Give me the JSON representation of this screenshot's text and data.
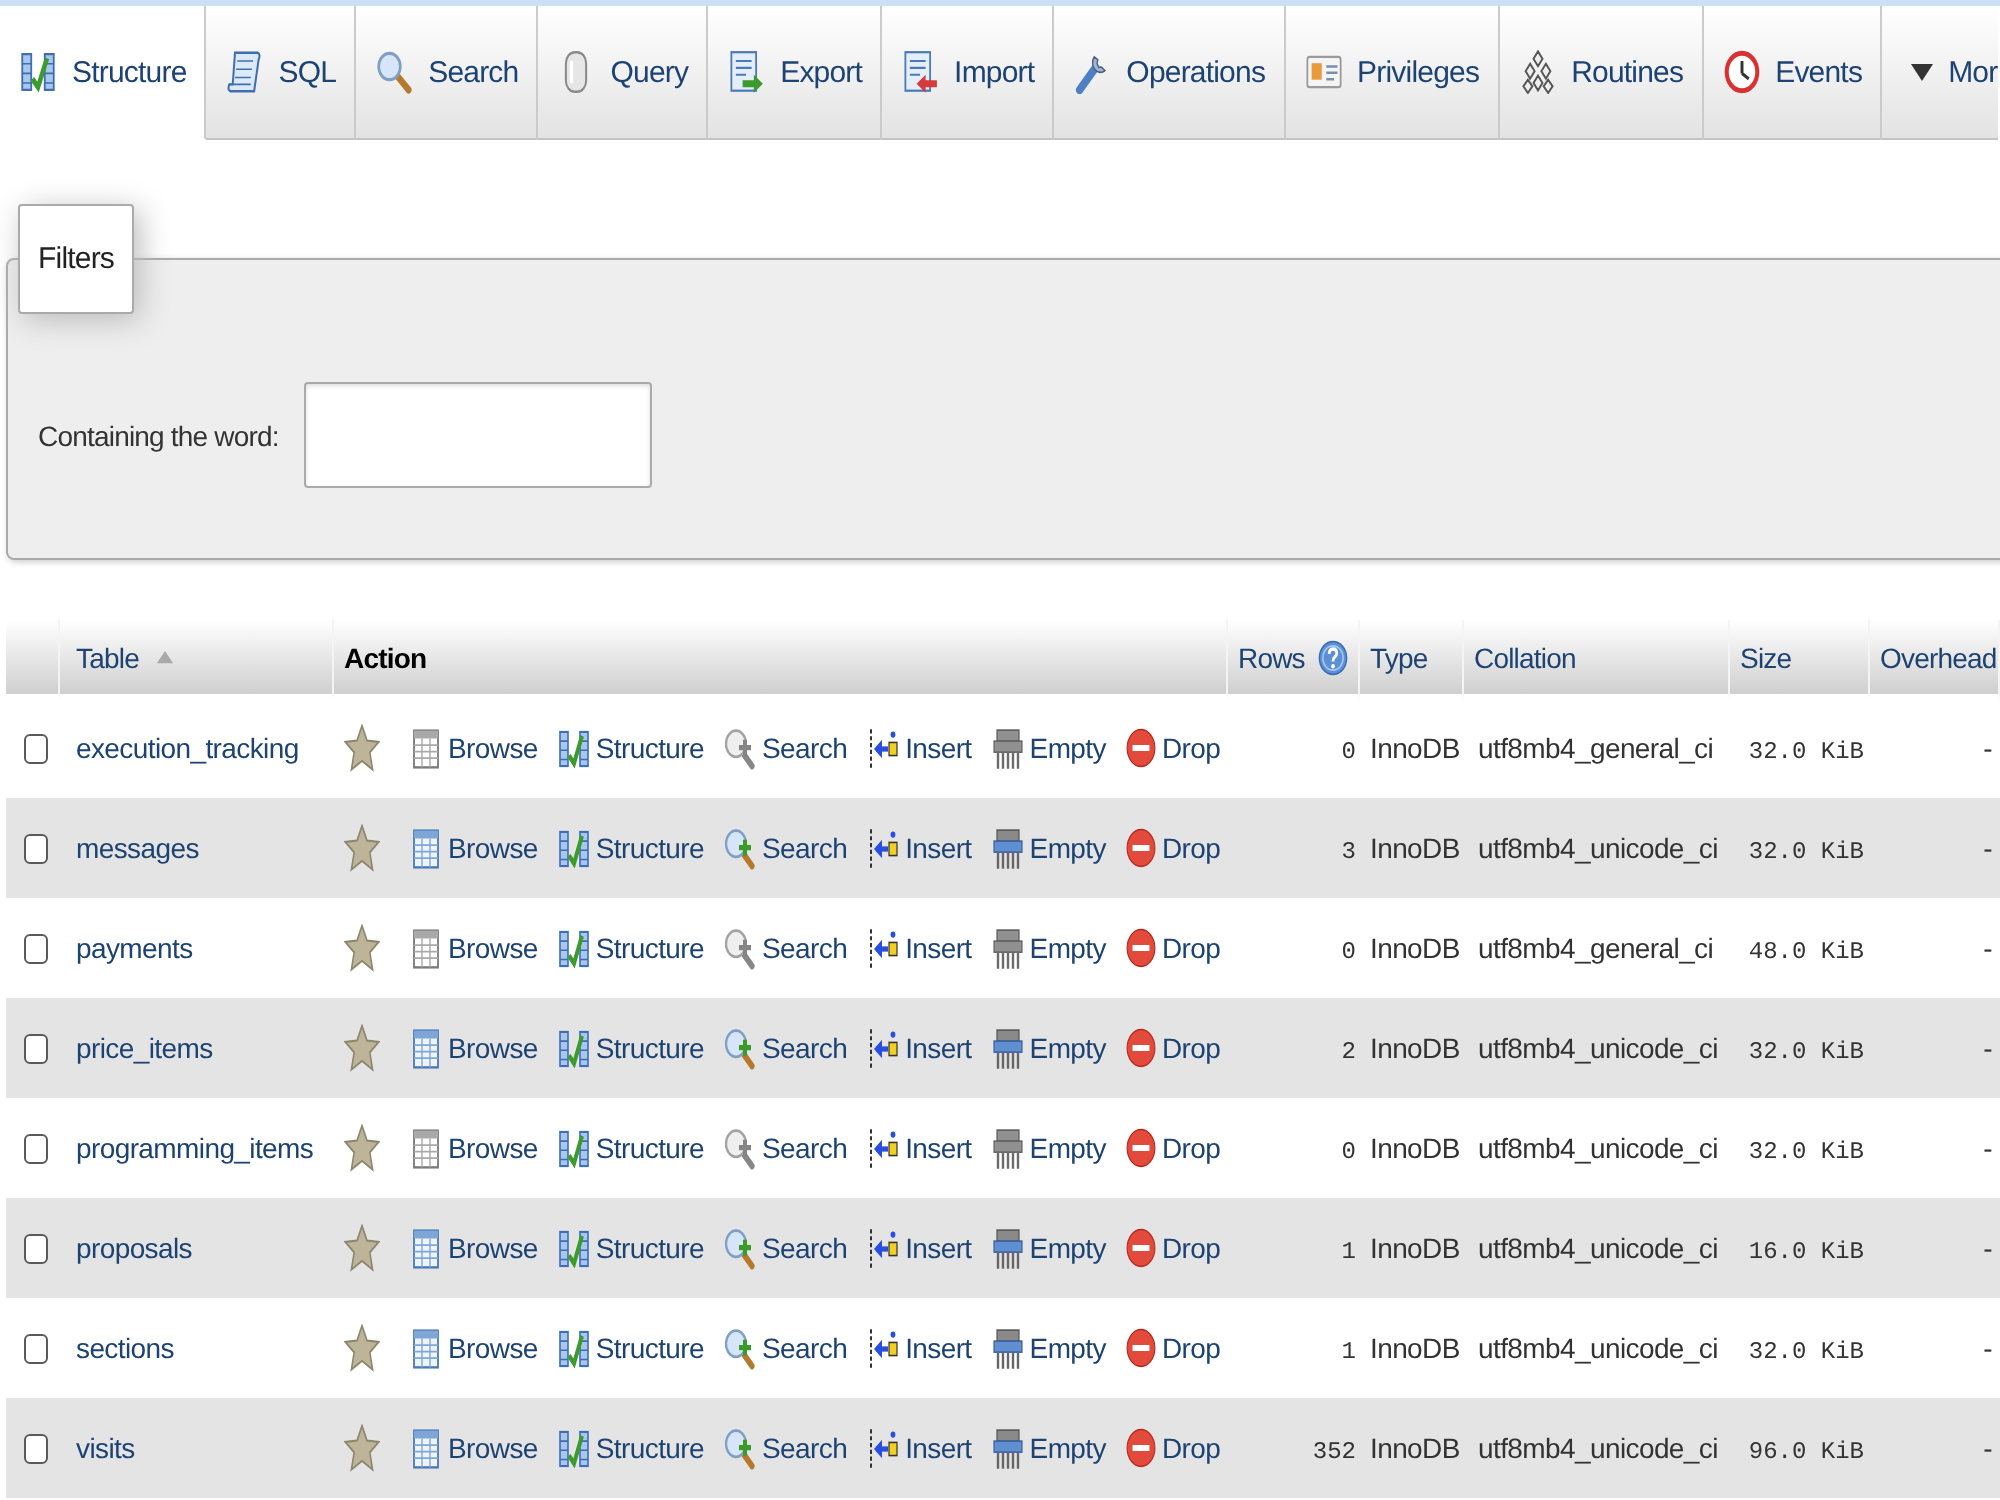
{
  "tabs": [
    {
      "kind": "structure",
      "label": "Structure",
      "selected": true
    },
    {
      "kind": "sql",
      "label": "SQL",
      "selected": false
    },
    {
      "kind": "search",
      "label": "Search",
      "selected": false
    },
    {
      "kind": "query",
      "label": "Query",
      "selected": false
    },
    {
      "kind": "export",
      "label": "Export",
      "selected": false
    },
    {
      "kind": "import",
      "label": "Import",
      "selected": false
    },
    {
      "kind": "operations",
      "label": "Operations",
      "selected": false
    },
    {
      "kind": "privileges",
      "label": "Privileges",
      "selected": false
    },
    {
      "kind": "routines",
      "label": "Routines",
      "selected": false
    },
    {
      "kind": "events",
      "label": "Events",
      "selected": false
    },
    {
      "kind": "more",
      "label": "Mor",
      "selected": false
    }
  ],
  "filters": {
    "legend": "Filters",
    "label": "Containing the word:"
  },
  "table": {
    "columns": [
      {
        "label": "Table",
        "sortable": true,
        "sorted": true,
        "help": false
      },
      {
        "label": "Action",
        "sortable": false,
        "sorted": false,
        "help": false
      },
      {
        "label": "Rows",
        "sortable": true,
        "sorted": false,
        "help": true
      },
      {
        "label": "Type",
        "sortable": true,
        "sorted": false,
        "help": false
      },
      {
        "label": "Collation",
        "sortable": true,
        "sorted": false,
        "help": false
      },
      {
        "label": "Size",
        "sortable": true,
        "sorted": false,
        "help": false
      },
      {
        "label": "Overhead",
        "sortable": true,
        "sorted": false,
        "help": false
      }
    ],
    "rows": [
      {
        "checked": false,
        "name": "execution_tracking",
        "favorite": false,
        "actions": [
          {
            "kind": "browse",
            "label": "Browse",
            "disabled": true
          },
          {
            "kind": "structure",
            "label": "Structure",
            "disabled": false
          },
          {
            "kind": "search",
            "label": "Search",
            "disabled": true
          },
          {
            "kind": "insert",
            "label": "Insert",
            "disabled": false
          },
          {
            "kind": "empty",
            "label": "Empty",
            "disabled": true
          },
          {
            "kind": "drop",
            "label": "Drop",
            "disabled": false
          }
        ],
        "rows": "0",
        "type": "InnoDB",
        "collation": "utf8mb4_general_ci",
        "size": "32.0 KiB",
        "overhead": "-"
      },
      {
        "checked": false,
        "name": "messages",
        "favorite": false,
        "actions": [
          {
            "kind": "browse",
            "label": "Browse",
            "disabled": false
          },
          {
            "kind": "structure",
            "label": "Structure",
            "disabled": false
          },
          {
            "kind": "search",
            "label": "Search",
            "disabled": false
          },
          {
            "kind": "insert",
            "label": "Insert",
            "disabled": false
          },
          {
            "kind": "empty",
            "label": "Empty",
            "disabled": false
          },
          {
            "kind": "drop",
            "label": "Drop",
            "disabled": false
          }
        ],
        "rows": "3",
        "type": "InnoDB",
        "collation": "utf8mb4_unicode_ci",
        "size": "32.0 KiB",
        "overhead": "-"
      },
      {
        "checked": false,
        "name": "payments",
        "favorite": false,
        "actions": [
          {
            "kind": "browse",
            "label": "Browse",
            "disabled": true
          },
          {
            "kind": "structure",
            "label": "Structure",
            "disabled": false
          },
          {
            "kind": "search",
            "label": "Search",
            "disabled": true
          },
          {
            "kind": "insert",
            "label": "Insert",
            "disabled": false
          },
          {
            "kind": "empty",
            "label": "Empty",
            "disabled": true
          },
          {
            "kind": "drop",
            "label": "Drop",
            "disabled": false
          }
        ],
        "rows": "0",
        "type": "InnoDB",
        "collation": "utf8mb4_general_ci",
        "size": "48.0 KiB",
        "overhead": "-"
      },
      {
        "checked": false,
        "name": "price_items",
        "favorite": false,
        "actions": [
          {
            "kind": "browse",
            "label": "Browse",
            "disabled": false
          },
          {
            "kind": "structure",
            "label": "Structure",
            "disabled": false
          },
          {
            "kind": "search",
            "label": "Search",
            "disabled": false
          },
          {
            "kind": "insert",
            "label": "Insert",
            "disabled": false
          },
          {
            "kind": "empty",
            "label": "Empty",
            "disabled": false
          },
          {
            "kind": "drop",
            "label": "Drop",
            "disabled": false
          }
        ],
        "rows": "2",
        "type": "InnoDB",
        "collation": "utf8mb4_unicode_ci",
        "size": "32.0 KiB",
        "overhead": "-"
      },
      {
        "checked": false,
        "name": "programming_items",
        "favorite": false,
        "actions": [
          {
            "kind": "browse",
            "label": "Browse",
            "disabled": true
          },
          {
            "kind": "structure",
            "label": "Structure",
            "disabled": false
          },
          {
            "kind": "search",
            "label": "Search",
            "disabled": true
          },
          {
            "kind": "insert",
            "label": "Insert",
            "disabled": false
          },
          {
            "kind": "empty",
            "label": "Empty",
            "disabled": true
          },
          {
            "kind": "drop",
            "label": "Drop",
            "disabled": false
          }
        ],
        "rows": "0",
        "type": "InnoDB",
        "collation": "utf8mb4_unicode_ci",
        "size": "32.0 KiB",
        "overhead": "-"
      },
      {
        "checked": false,
        "name": "proposals",
        "favorite": false,
        "actions": [
          {
            "kind": "browse",
            "label": "Browse",
            "disabled": false
          },
          {
            "kind": "structure",
            "label": "Structure",
            "disabled": false
          },
          {
            "kind": "search",
            "label": "Search",
            "disabled": false
          },
          {
            "kind": "insert",
            "label": "Insert",
            "disabled": false
          },
          {
            "kind": "empty",
            "label": "Empty",
            "disabled": false
          },
          {
            "kind": "drop",
            "label": "Drop",
            "disabled": false
          }
        ],
        "rows": "1",
        "type": "InnoDB",
        "collation": "utf8mb4_unicode_ci",
        "size": "16.0 KiB",
        "overhead": "-"
      },
      {
        "checked": false,
        "name": "sections",
        "favorite": false,
        "actions": [
          {
            "kind": "browse",
            "label": "Browse",
            "disabled": false
          },
          {
            "kind": "structure",
            "label": "Structure",
            "disabled": false
          },
          {
            "kind": "search",
            "label": "Search",
            "disabled": false
          },
          {
            "kind": "insert",
            "label": "Insert",
            "disabled": false
          },
          {
            "kind": "empty",
            "label": "Empty",
            "disabled": false
          },
          {
            "kind": "drop",
            "label": "Drop",
            "disabled": false
          }
        ],
        "rows": "1",
        "type": "InnoDB",
        "collation": "utf8mb4_unicode_ci",
        "size": "32.0 KiB",
        "overhead": "-"
      },
      {
        "checked": false,
        "name": "visits",
        "favorite": false,
        "actions": [
          {
            "kind": "browse",
            "label": "Browse",
            "disabled": false
          },
          {
            "kind": "structure",
            "label": "Structure",
            "disabled": false
          },
          {
            "kind": "search",
            "label": "Search",
            "disabled": false
          },
          {
            "kind": "insert",
            "label": "Insert",
            "disabled": false
          },
          {
            "kind": "empty",
            "label": "Empty",
            "disabled": false
          },
          {
            "kind": "drop",
            "label": "Drop",
            "disabled": false
          }
        ],
        "rows": "352",
        "type": "InnoDB",
        "collation": "utf8mb4_unicode_ci",
        "size": "96.0 KiB",
        "overhead": "-"
      }
    ]
  }
}
